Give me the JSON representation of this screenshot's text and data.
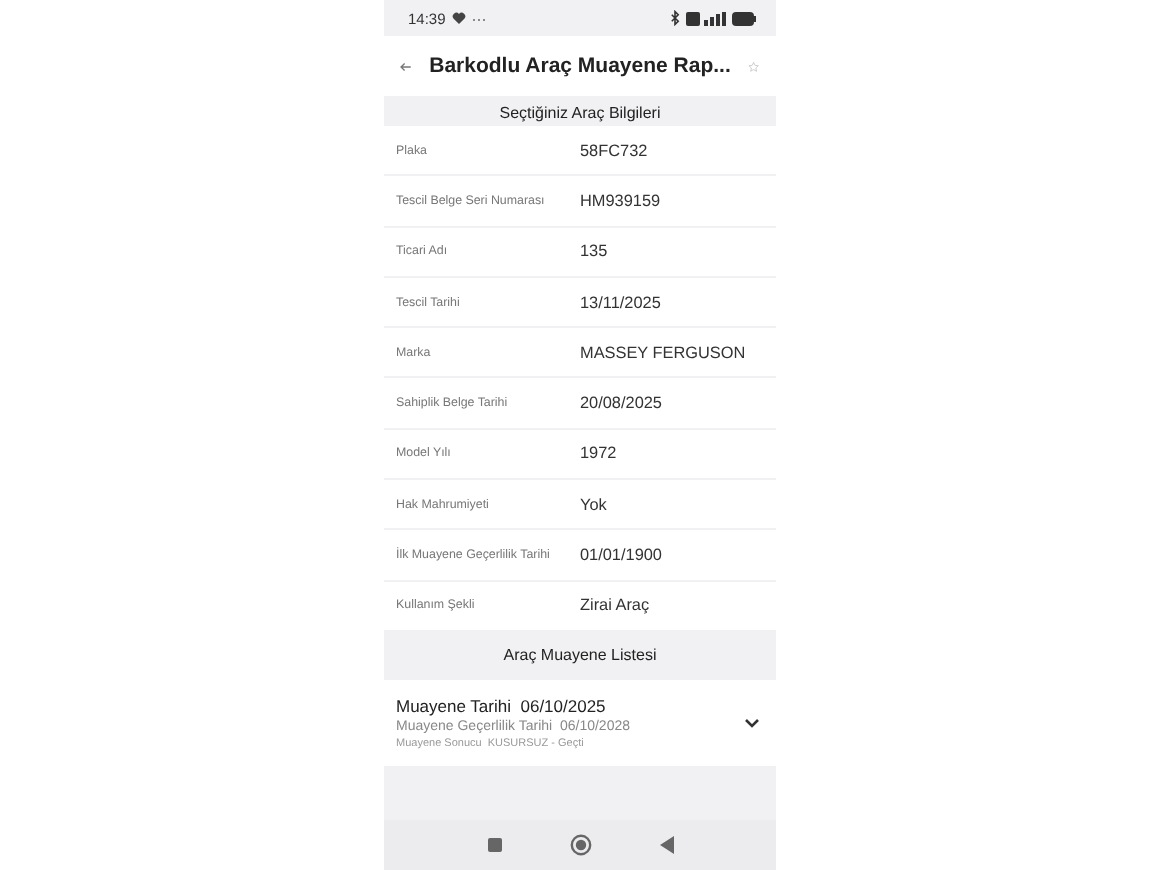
{
  "status_bar": {
    "time": "14:39",
    "more": "···"
  },
  "header": {
    "title": "Barkodlu Araç Muayene Rap...",
    "favorite": false
  },
  "vehicle_section": {
    "title": "Seçtiğiniz Araç Bilgileri",
    "rows": [
      {
        "label": "Plaka",
        "value": "58FC732"
      },
      {
        "label": "Tescil Belge Seri Numarası",
        "value": "HM939159"
      },
      {
        "label": "Ticari Adı",
        "value": "135"
      },
      {
        "label": "Tescil Tarihi",
        "value": "13/11/2025"
      },
      {
        "label": "Marka",
        "value": "MASSEY FERGUSON"
      },
      {
        "label": "Sahiplik Belge Tarihi",
        "value": "20/08/2025"
      },
      {
        "label": "Model Yılı",
        "value": "1972"
      },
      {
        "label": "Hak Mahrumiyeti",
        "value": "Yok"
      },
      {
        "label": "İlk Muayene Geçerlilik Tarihi",
        "value": "01/01/1900"
      },
      {
        "label": "Kullanım Şekli",
        "value": "Zirai Araç"
      }
    ]
  },
  "inspection_section": {
    "title": "Araç Muayene Listesi",
    "items": [
      {
        "date_label": "Muayene Tarihi",
        "date": "06/10/2025",
        "validity_label": "Muayene Geçerlilik Tarihi",
        "validity": "06/10/2028",
        "result_label": "Muayene Sonucu",
        "result": "KUSURSUZ - Geçti",
        "expanded": false
      }
    ]
  }
}
